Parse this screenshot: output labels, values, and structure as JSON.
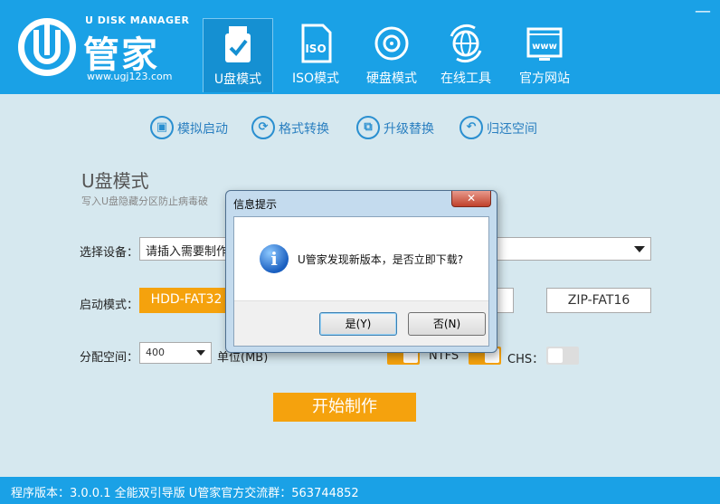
{
  "app": {
    "logo_sup": "U DISK MANAGER",
    "logo_name": "管家",
    "logo_url": "www.ugj123.com",
    "close_glyph": "—"
  },
  "nav": [
    {
      "label": "U盘模式",
      "icon": "usb-check-icon",
      "active": true
    },
    {
      "label": "ISO模式",
      "icon": "iso-icon",
      "active": false
    },
    {
      "label": "硬盘模式",
      "icon": "disk-icon",
      "active": false
    },
    {
      "label": "在线工具",
      "icon": "globe-icon",
      "active": false
    },
    {
      "label": "官方网站",
      "icon": "www-icon",
      "active": false
    }
  ],
  "tools": [
    {
      "label": "模拟启动",
      "icon": "monitor-icon",
      "glyph": "▣"
    },
    {
      "label": "格式转换",
      "icon": "refresh-icon",
      "glyph": "⟳"
    },
    {
      "label": "升级替换",
      "icon": "swap-icon",
      "glyph": "⧉"
    },
    {
      "label": "归还空间",
      "icon": "return-icon",
      "glyph": "↶"
    }
  ],
  "main": {
    "title": "U盘模式",
    "desc": "写入U盘隐藏分区防止病毒破",
    "device_label": "选择设备：",
    "device_value": "请插入需要制作",
    "boot_label": "启动模式：",
    "boot_modes": [
      {
        "label": "HDD-FAT32",
        "active": true
      },
      {
        "label": "ZIP-FAT16",
        "active": false
      }
    ],
    "alloc_label": "分配空间：",
    "alloc_value": "400",
    "alloc_unit_partial": "单位(MB)",
    "ntfs_label": "NTFS",
    "chs_label": "CHS：",
    "start_button": "开始制作"
  },
  "footer": {
    "text": "程序版本：3.0.0.1 全能双引导版 U管家官方交流群：563744852"
  },
  "dialog": {
    "title": "信息提示",
    "close_glyph": "✕",
    "message": "U管家发现新版本，是否立即下载?",
    "yes_label": "是(Y)",
    "no_label": "否(N)"
  },
  "colors": {
    "header": "#1aa1e6",
    "accent": "#f5a20d",
    "body_bg": "#d6e8ef"
  }
}
